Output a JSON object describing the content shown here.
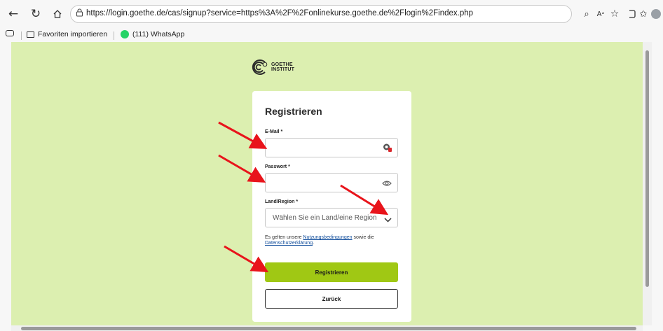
{
  "browser": {
    "url": "https://login.goethe.de/cas/signup?service=https%3A%2F%2Fonlinekurse.goethe.de%2Flogin%2Findex.php",
    "icons": [
      "back-arrow-icon",
      "refresh-icon",
      "home-icon",
      "lock-icon",
      "zoom-icon",
      "read-aloud-icon",
      "favorite-star-icon",
      "extensions-icon",
      "favorites-icon",
      "profile-icon",
      "more-icon"
    ]
  },
  "bookmarks": {
    "import": "Favoriten importieren",
    "whatsapp": "(111) WhatsApp"
  },
  "page": {
    "logo_line1": "GOETHE",
    "logo_line2": "INSTITUT",
    "title": "Registrieren",
    "email_label": "E-Mail *",
    "password_label": "Passwort *",
    "region_label": "Land/Region *",
    "region_placeholder": "Wählen Sie ein Land/eine Region",
    "legal_prefix": "Es gelten unsere ",
    "legal_terms": "Nutzungsbedingungen",
    "legal_middle": " sowie die ",
    "legal_privacy": "Datenschutzerklärung",
    "legal_suffix": ".",
    "register_button": "Registrieren",
    "back_button": "Zurück"
  },
  "colors": {
    "page_bg": "#dcefb0",
    "primary_button": "#a0c814",
    "link": "#0f4c9b",
    "annotation_arrow": "#e8141b"
  }
}
